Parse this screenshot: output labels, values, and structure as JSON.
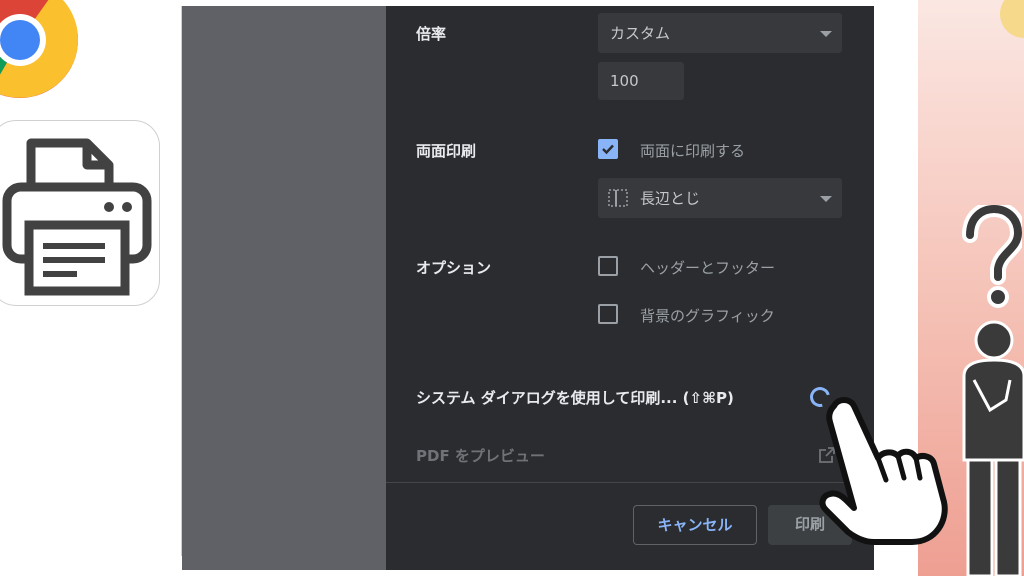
{
  "scale": {
    "label": "倍率",
    "select_value": "カスタム",
    "input_value": "100"
  },
  "duplex": {
    "label": "両面印刷",
    "checkbox_label": "両面に印刷する",
    "checked": true,
    "binding_value": "長辺とじ"
  },
  "options": {
    "label": "オプション",
    "items": [
      {
        "label": "ヘッダーとフッター",
        "checked": false
      },
      {
        "label": "背景のグラフィック",
        "checked": false
      }
    ]
  },
  "system_dialog": {
    "text": "システム ダイアログを使用して印刷... (⇧⌘P)"
  },
  "pdf_preview": {
    "text": "PDF をプレビュー"
  },
  "buttons": {
    "cancel": "キャンセル",
    "print": "印刷"
  },
  "colors": {
    "dialog_bg": "#2b2c2f",
    "accent_blue": "#8ab4f8",
    "preview_grey": "#5f6166"
  },
  "icons": [
    "chrome-logo-icon",
    "printer-icon",
    "question-mark-icon",
    "thinking-person-icon",
    "pointing-hand-icon",
    "spinner-icon",
    "open-external-icon",
    "binding-edge-icon"
  ]
}
